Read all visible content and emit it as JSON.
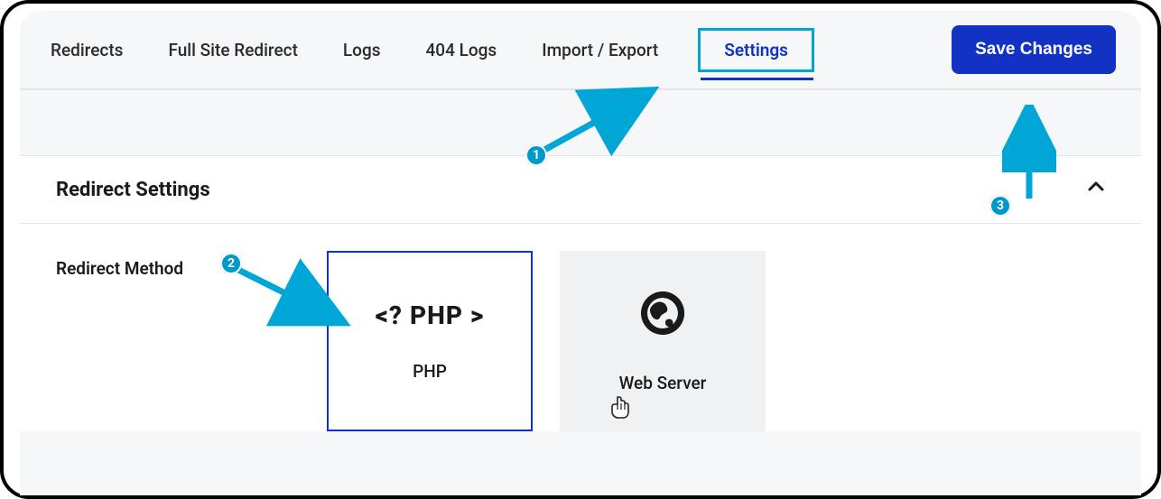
{
  "tabs": {
    "redirects": "Redirects",
    "full_site": "Full Site Redirect",
    "logs": "Logs",
    "logs404": "404 Logs",
    "import_export": "Import / Export",
    "settings": "Settings"
  },
  "save_button": "Save Changes",
  "panel": {
    "title": "Redirect Settings",
    "field_label": "Redirect Method",
    "option_php": "PHP",
    "php_glyph": "<? PHP >",
    "option_webserver": "Web Server"
  },
  "annotations": {
    "badge1": "1",
    "badge2": "2",
    "badge3": "3"
  }
}
